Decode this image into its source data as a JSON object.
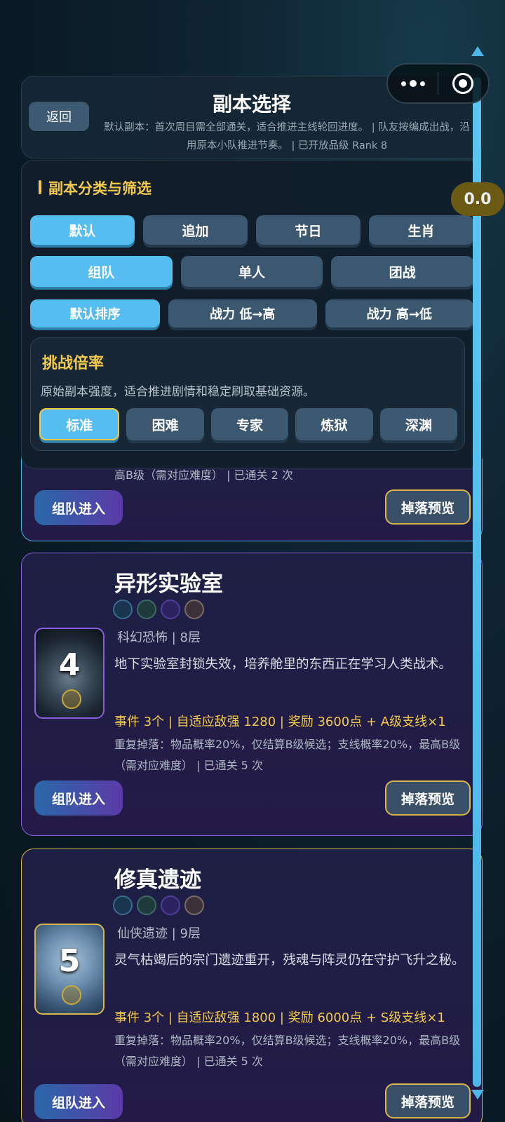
{
  "header": {
    "back_label": "返回",
    "title": "副本选择",
    "subtitle": "默认副本：首次周目需全部通关，适合推进主线轮回进度。 | 队友按编成出战，沿用原本小队推进节奏。 | 已开放品级 Rank 8"
  },
  "zoom_badge": "0.0",
  "filter": {
    "title": "副本分类与筛选",
    "category_tabs": [
      "默认",
      "追加",
      "节日",
      "生肖"
    ],
    "mode_tabs": [
      "组队",
      "单人",
      "团战"
    ],
    "sort_tabs": [
      "默认排序",
      "战力 低→高",
      "战力 高→低"
    ],
    "difficulty": {
      "title": "挑战倍率",
      "description": "原始副本强度，适合推进剧情和稳定刷取基础资源。",
      "options": [
        "标准",
        "困难",
        "专家",
        "炼狱",
        "深渊"
      ],
      "selected": "标准"
    }
  },
  "cards": [
    {
      "repeat_tail": "高B级（需对应难度） | 已通关 2 次",
      "team_button": "组队进入",
      "drop_button": "掉落预览"
    },
    {
      "number": "4",
      "name": "异形实验室",
      "meta": "科幻恐怖 | 8层",
      "description": "地下实验室封锁失效，培养舱里的东西正在学习人类战术。",
      "stats": "事件 3个 | 自适应敌强 1280 | 奖励 3600点 + A级支线×1",
      "repeat": "重复掉落：物品概率20%，仅结算B级候选；支线概率20%，最高B级（需对应难度） | 已通关 5 次",
      "team_button": "组队进入",
      "drop_button": "掉落预览"
    },
    {
      "number": "5",
      "name": "修真遗迹",
      "meta": "仙侠遗迹 | 9层",
      "description": "灵气枯竭后的宗门遗迹重开，残魂与阵灵仍在守护飞升之秘。",
      "stats": "事件 3个 | 自适应敌强 1800 | 奖励 6000点 + S级支线×1",
      "repeat": "重复掉落：物品概率20%，仅结算B级候选；支线概率20%，最高B级（需对应难度） | 已通关 5 次",
      "team_button": "组队进入",
      "drop_button": "掉落预览"
    }
  ],
  "colors": {
    "accent": "#55bdf0",
    "gold": "#f2c94c",
    "purple_border": "#8a5ee0"
  }
}
